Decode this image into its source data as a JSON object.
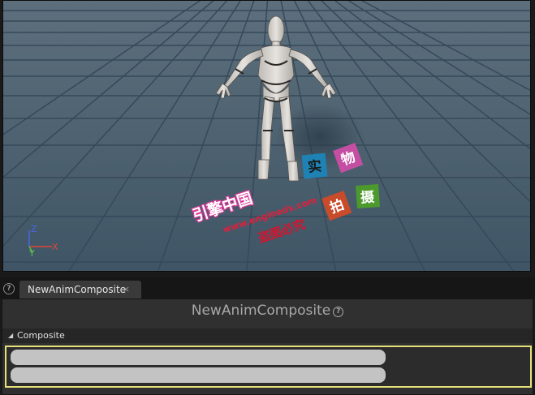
{
  "viewport": {
    "axis_labels": {
      "z": "Z",
      "y": "Y",
      "x": "X"
    },
    "watermark": {
      "brand": "引擎中国",
      "url": "www.enginedx.com",
      "notice": "盗图必究",
      "tiles": [
        "实",
        "物",
        "拍",
        "摄"
      ]
    }
  },
  "tab": {
    "label": "NewAnimComposite",
    "close": "×"
  },
  "panel": {
    "title": "NewAnimComposite",
    "help_glyph": "?",
    "section": {
      "arrow": "◢",
      "label": "Composite"
    }
  },
  "tabstrip": {
    "help_glyph": "?"
  },
  "colors": {
    "selection_outline": "#e6e07a",
    "track_bar": "#c3c3c3",
    "floor": "#4e6272",
    "x_axis": "#e0463a",
    "y_axis": "#56c24a",
    "z_axis": "#4a66e8"
  }
}
